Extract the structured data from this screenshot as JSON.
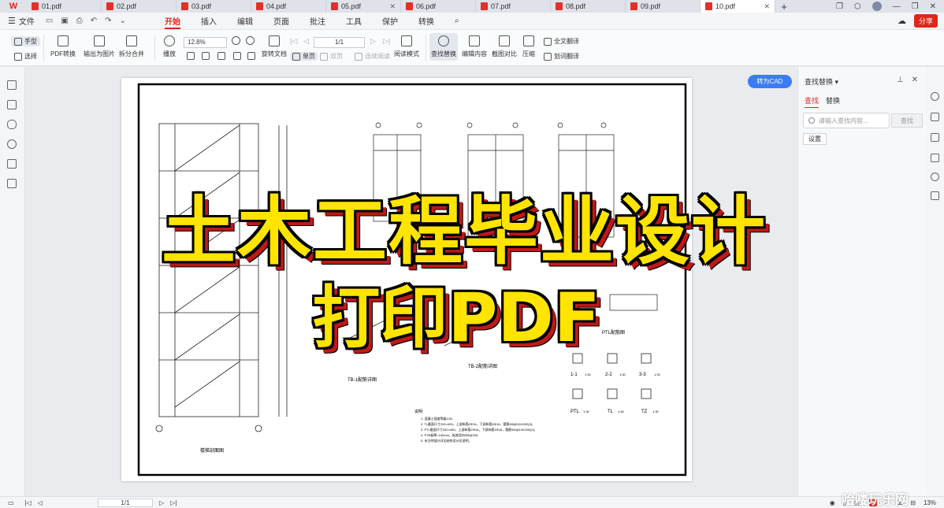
{
  "app": {
    "logo": "W",
    "file_menu": "文件",
    "share": "分享"
  },
  "tabs": [
    {
      "label": "01.pdf"
    },
    {
      "label": "02.pdf"
    },
    {
      "label": "03.pdf"
    },
    {
      "label": "04.pdf"
    },
    {
      "label": "05.pdf"
    },
    {
      "label": "06.pdf"
    },
    {
      "label": "07.pdf"
    },
    {
      "label": "08.pdf"
    },
    {
      "label": "09.pdf"
    },
    {
      "label": "10.pdf"
    }
  ],
  "menus": [
    "开始",
    "插入",
    "编辑",
    "页面",
    "批注",
    "工具",
    "保护",
    "转换"
  ],
  "ribbon": {
    "hand": "手型",
    "select": "选择",
    "pdf_convert": "PDF转换",
    "to_image": "输出为图片",
    "split_merge": "拆分合并",
    "play": "播放",
    "zoom": "12.8%",
    "rotate": "旋转文档",
    "single_page": "单页",
    "double_page": "双页",
    "continuous": "连续阅读",
    "read_mode": "阅读模式",
    "page": "1/1",
    "find_replace": "查找替换",
    "edit_content": "编辑内容",
    "screenshot_compare": "截图对比",
    "compress": "压缩",
    "full_translate": "全文翻译",
    "word_translate": "划词翻译"
  },
  "cad_button": "转为CAD",
  "drawing": {
    "stair_section_title": "楼梯剖面图",
    "tb1_title": "TB-1配筋详图",
    "tb2_title": "TB-2配筋详图",
    "ptl_title": "PTL配筋图",
    "sections": [
      "1-1",
      "2-2",
      "3-3",
      "PTL",
      "TL",
      "TZ"
    ],
    "scale": "1:30",
    "notes_title": "说明:",
    "notes": [
      "1. 混凝土强度等级C30;",
      "2. TL截面尺寸200×400，上部纵筋2Φ16，下部纵筋3Φ16，箍筋Φ8@100/200(2);",
      "3. PTL截面尺寸200×400，上部纵筋2Φ16，下部纵筋3Φ16，箍筋Φ8@100/200(2);",
      "4. PTB板厚=100mm，板底双向Φ8@200;",
      "5. 未注明部分详见结构设计总说明。"
    ]
  },
  "headline": {
    "line1": "土木工程毕业设计",
    "line2": "打印PDF"
  },
  "right_panel": {
    "title": "查找替换",
    "tab_find": "查找",
    "tab_replace": "替换",
    "search_placeholder": "请输入查找内容...",
    "find_button": "查找",
    "settings_button": "设置"
  },
  "status": {
    "page": "1/1",
    "zoom": "13%"
  },
  "watermark": "哈喽玩乐网"
}
